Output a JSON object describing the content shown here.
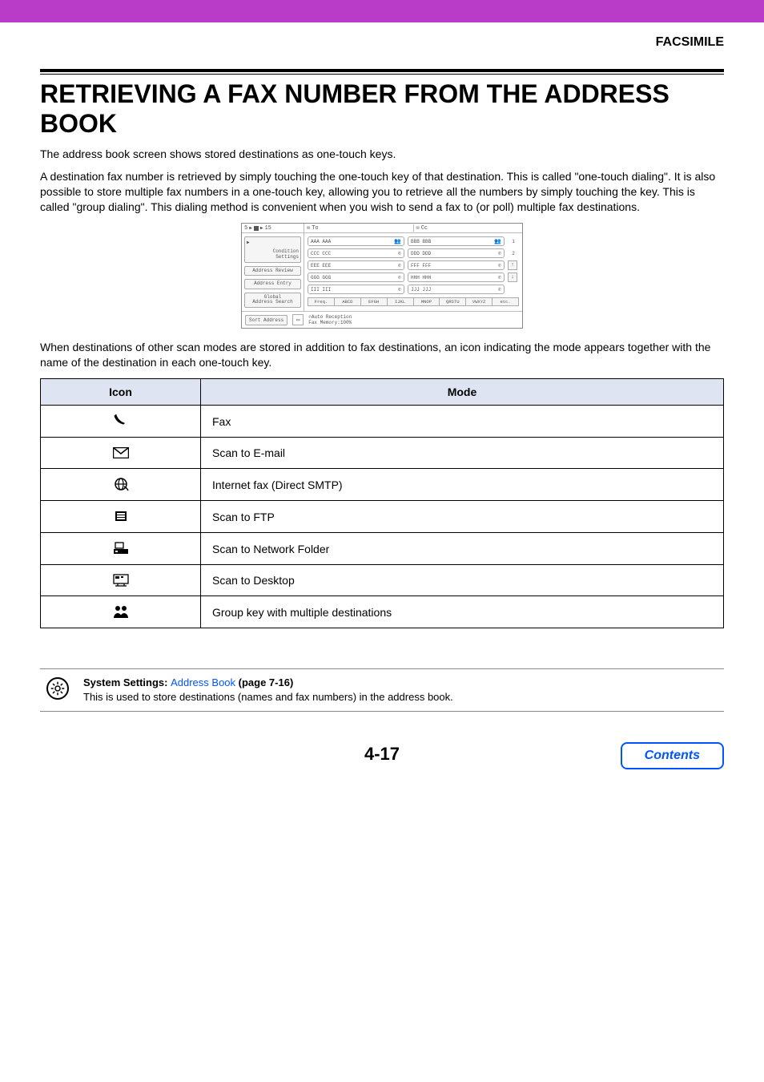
{
  "header": {
    "section_label": "FACSIMILE"
  },
  "title": "RETRIEVING A FAX NUMBER FROM THE ADDRESS BOOK",
  "paragraphs": {
    "p1": "The address book screen shows stored destinations as one-touch keys.",
    "p2": "A destination fax number is retrieved by simply touching the one-touch key of that destination. This is called \"one-touch dialing\". It is also possible to store multiple fax numbers in a one-touch key, allowing you to retrieve all the numbers by simply touching the key. This is called \"group dialing\". This dialing method is convenient when you wish to send a fax to (or poll) multiple fax destinations.",
    "p3": "When destinations of other scan modes are stored in addition to fax destinations, an icon indicating the mode appears together with the name of the destination in each one-touch key."
  },
  "fax_panel": {
    "top": {
      "stepper": {
        "current": "5",
        "of_icon": "▶",
        "max": "15"
      },
      "to_label": "To",
      "cc_label": "Cc"
    },
    "side": {
      "condition": "Condition\nSettings",
      "review": "Address Review",
      "entry": "Address Entry",
      "global": "Global\nAddress Search"
    },
    "keys": [
      {
        "label": "AAA AAA",
        "icon": "group"
      },
      {
        "label": "BBB BBB",
        "icon": "group"
      },
      {
        "label": "CCC CCC",
        "icon": "phone"
      },
      {
        "label": "DDD DDD",
        "icon": "phone"
      },
      {
        "label": "EEE EEE",
        "icon": "phone"
      },
      {
        "label": "FFF FFF",
        "icon": "phone"
      },
      {
        "label": "GGG GGG",
        "icon": "phone"
      },
      {
        "label": "HHH HHH",
        "icon": "phone"
      },
      {
        "label": "III III",
        "icon": "phone"
      },
      {
        "label": "JJJ JJJ",
        "icon": "phone"
      }
    ],
    "page": {
      "current": "1",
      "total": "2"
    },
    "tabs": [
      "Freq.",
      "ABCD",
      "EFGH",
      "IJKL",
      "MNOP",
      "QRSTU",
      "VWXYZ",
      "etc."
    ],
    "bottom": {
      "sort": "Sort Address",
      "status_icon": "☎",
      "status1": "Auto Reception",
      "status2": "Fax Memory:100%"
    }
  },
  "table": {
    "headers": {
      "icon": "Icon",
      "mode": "Mode"
    },
    "rows": [
      {
        "mode": "Fax",
        "icon_name": "fax-phone-icon"
      },
      {
        "mode": "Scan to E-mail",
        "icon_name": "email-envelope-icon"
      },
      {
        "mode": "Internet fax (Direct SMTP)",
        "icon_name": "internet-fax-icon"
      },
      {
        "mode": "Scan to FTP",
        "icon_name": "ftp-server-icon"
      },
      {
        "mode": "Scan to Network Folder",
        "icon_name": "network-folder-icon"
      },
      {
        "mode": "Scan to Desktop",
        "icon_name": "desktop-icon"
      },
      {
        "mode": "Group key with multiple destinations",
        "icon_name": "group-people-icon"
      }
    ]
  },
  "callout": {
    "bold_prefix": "System Settings: ",
    "link_text": "Address Book",
    "page_ref": " (page 7-16)",
    "desc": "This is used to store destinations (names and fax numbers) in the address book."
  },
  "footer": {
    "page_number": "4-17",
    "contents_label": "Contents"
  }
}
